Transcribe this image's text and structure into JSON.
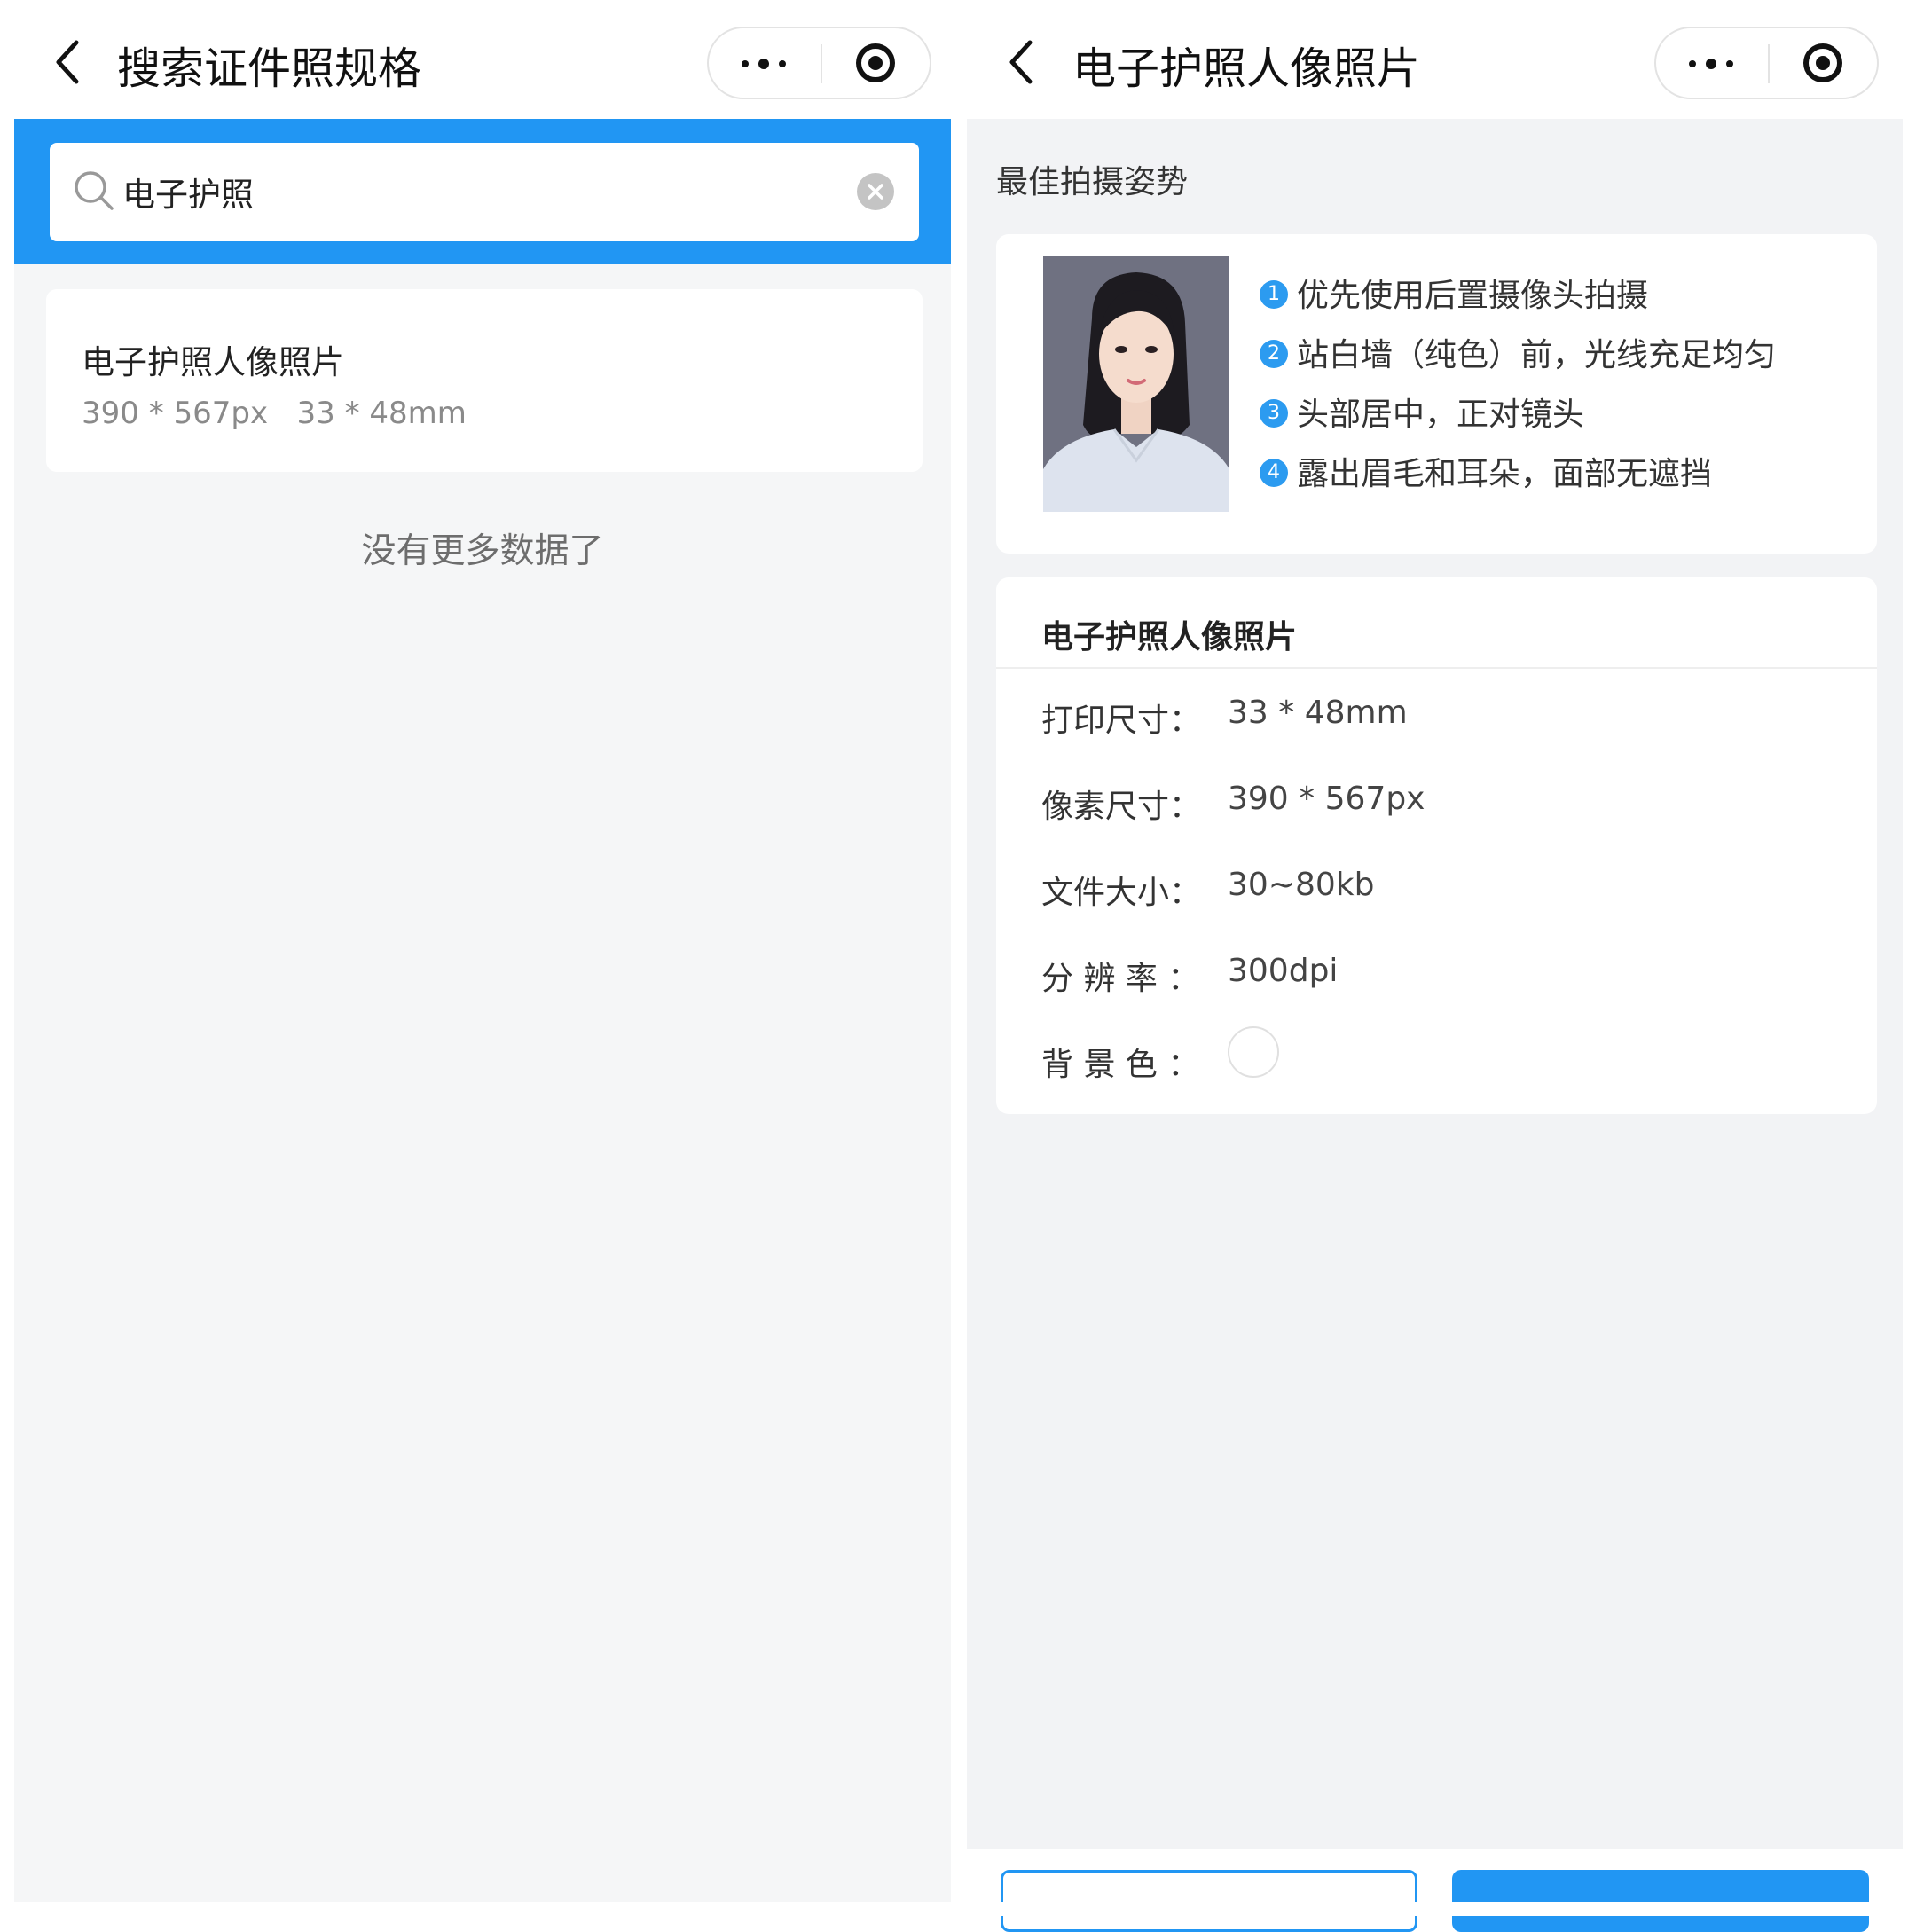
{
  "colors": {
    "accent": "#2196f3",
    "page_bg": "#f5f6f7",
    "tip_badge": "#2c9bf0",
    "portrait_bg": "#6f7181",
    "swatch": "#ffffff"
  },
  "left": {
    "nav": {
      "title": "搜索证件照规格",
      "icons": [
        "chevron-left-icon",
        "more-dots-icon",
        "target-close-icon"
      ]
    },
    "search": {
      "value": "电子护照",
      "icons": [
        "search-icon",
        "clear-icon"
      ]
    },
    "results": [
      {
        "title": "电子护照人像照片",
        "subtitle": "390 * 567px   33 * 48mm"
      }
    ],
    "end_text": "没有更多数据了"
  },
  "right": {
    "nav": {
      "title": "电子护照人像照片",
      "icons": [
        "chevron-left-icon",
        "more-dots-icon",
        "target-close-icon"
      ]
    },
    "pose_section_title": "最佳拍摄姿势",
    "tips": [
      {
        "num": "1",
        "text": "优先使用后置摄像头拍摄"
      },
      {
        "num": "2",
        "text": "站白墙（纯色）前，光线充足均匀"
      },
      {
        "num": "3",
        "text": "头部居中，正对镜头"
      },
      {
        "num": "4",
        "text": "露出眉毛和耳朵，面部无遮挡"
      }
    ],
    "spec": {
      "title": "电子护照人像照片",
      "rows": [
        {
          "label": "打印尺寸：",
          "value": "33 * 48mm"
        },
        {
          "label": "像素尺寸：",
          "value": "390 * 567px"
        },
        {
          "label": "文件大小：",
          "value": "30~80kb"
        },
        {
          "label": "分 辨 率 ：",
          "value": "300dpi"
        },
        {
          "label": "背 景 色 ：",
          "value": ""
        }
      ]
    }
  }
}
